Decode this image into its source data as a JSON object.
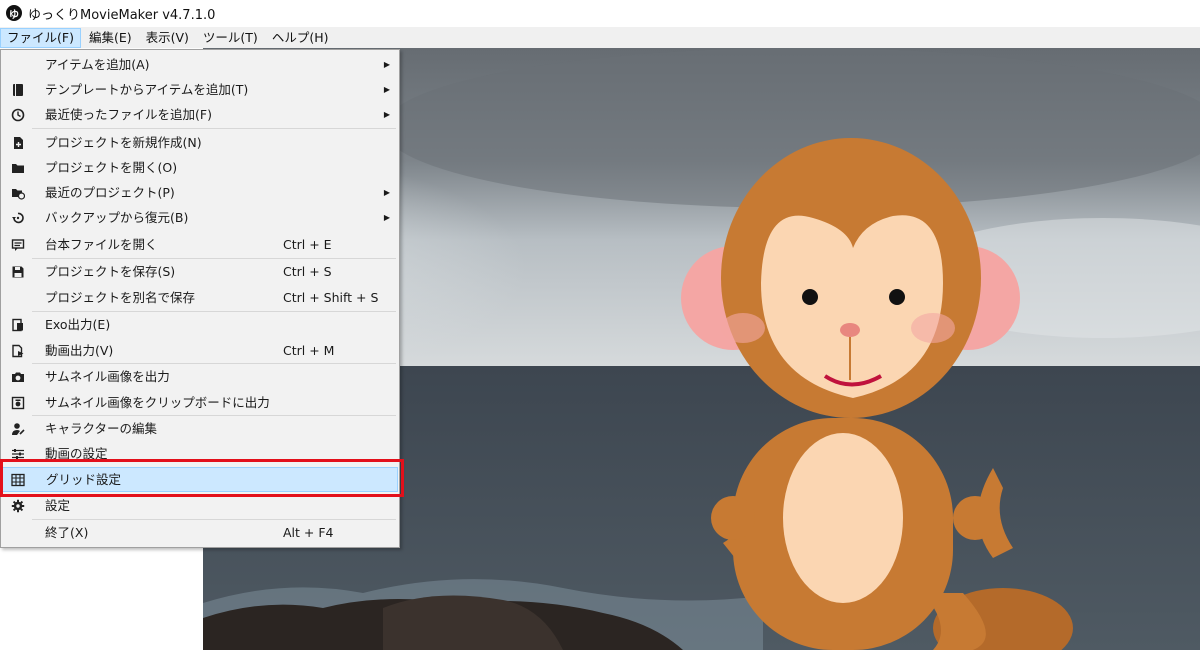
{
  "window": {
    "app_icon": "ゆ",
    "title": "ゆっくりMovieMaker v4.7.1.0"
  },
  "menubar": [
    "ファイル(F)",
    "編集(E)",
    "表示(V)",
    "ツール(T)",
    "ヘルプ(H)"
  ],
  "file_menu": {
    "items": [
      {
        "label": "アイテムを追加(A)",
        "shortcut": "",
        "submenu": "▶",
        "icon": ""
      },
      {
        "label": "テンプレートからアイテムを追加(T)",
        "shortcut": "",
        "submenu": "▶",
        "icon": "book-icon"
      },
      {
        "label": "最近使ったファイルを追加(F)",
        "shortcut": "",
        "submenu": "▶",
        "icon": "clock-icon"
      },
      {
        "label": "プロジェクトを新規作成(N)",
        "shortcut": "",
        "submenu": "",
        "icon": "new-file-icon"
      },
      {
        "label": "プロジェクトを開く(O)",
        "shortcut": "",
        "submenu": "",
        "icon": "folder-icon"
      },
      {
        "label": "最近のプロジェクト(P)",
        "shortcut": "",
        "submenu": "▶",
        "icon": "recent-folder-icon"
      },
      {
        "label": "バックアップから復元(B)",
        "shortcut": "",
        "submenu": "▶",
        "icon": "restore-icon"
      },
      {
        "label": "台本ファイルを開く",
        "shortcut": "Ctrl + E",
        "submenu": "",
        "icon": "script-icon"
      },
      {
        "label": "プロジェクトを保存(S)",
        "shortcut": "Ctrl + S",
        "submenu": "",
        "icon": "save-icon"
      },
      {
        "label": "プロジェクトを別名で保存",
        "shortcut": "Ctrl + Shift + S",
        "submenu": "",
        "icon": ""
      },
      {
        "label": "Exo出力(E)",
        "shortcut": "",
        "submenu": "",
        "icon": "exo-export-icon"
      },
      {
        "label": "動画出力(V)",
        "shortcut": "Ctrl + M",
        "submenu": "",
        "icon": "video-export-icon"
      },
      {
        "label": "サムネイル画像を出力",
        "shortcut": "",
        "submenu": "",
        "icon": "camera-icon"
      },
      {
        "label": "サムネイル画像をクリップボードに出力",
        "shortcut": "",
        "submenu": "",
        "icon": "camera-clipboard-icon"
      },
      {
        "label": "キャラクターの編集",
        "shortcut": "",
        "submenu": "",
        "icon": "character-edit-icon"
      },
      {
        "label": "動画の設定",
        "shortcut": "",
        "submenu": "",
        "icon": "sliders-icon"
      },
      {
        "label": "グリッド設定",
        "shortcut": "",
        "submenu": "",
        "icon": "grid-icon"
      },
      {
        "label": "設定",
        "shortcut": "",
        "submenu": "",
        "icon": "gear-icon"
      },
      {
        "label": "終了(X)",
        "shortcut": "Alt + F4",
        "submenu": "",
        "icon": ""
      }
    ],
    "highlighted_item": "グリッド設定",
    "highlight_color": "#cce8ff",
    "annotation_color": "#e3101b"
  }
}
